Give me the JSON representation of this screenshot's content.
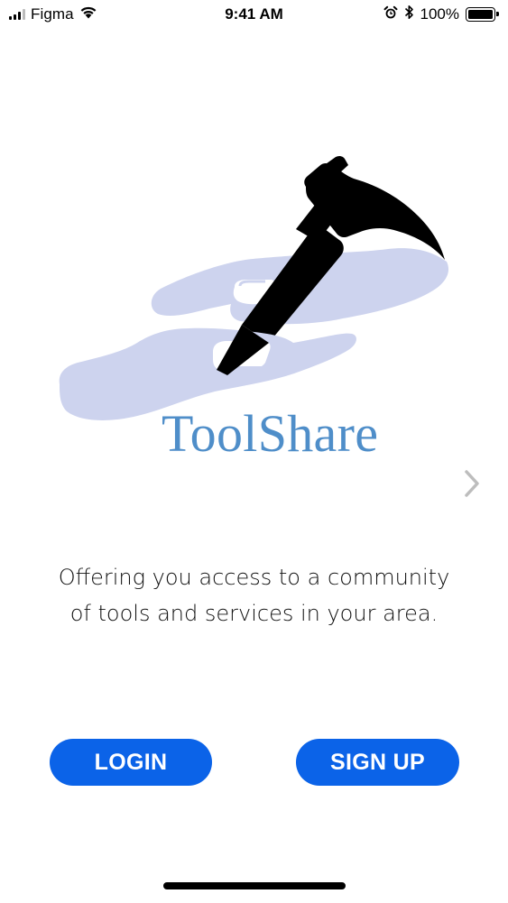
{
  "status_bar": {
    "carrier": "Figma",
    "time": "9:41 AM",
    "battery_percent": "100%",
    "icons": [
      "signal-icon",
      "wifi-icon",
      "alarm-icon",
      "bluetooth-icon",
      "battery-icon"
    ]
  },
  "brand": {
    "name": "ToolShare",
    "color": "#4f8ec9",
    "logo_icon": "hands-passing-hammer-icon",
    "hand_color": "#cdd3ee",
    "hammer_color": "#000000"
  },
  "carousel": {
    "next_icon": "chevron-right-icon"
  },
  "tagline": {
    "line1": "Offering you access to a community",
    "line2": "of tools and services in your area."
  },
  "actions": {
    "login_label": "LOGIN",
    "signup_label": "SIGN UP",
    "accent": "#0b63e8"
  }
}
